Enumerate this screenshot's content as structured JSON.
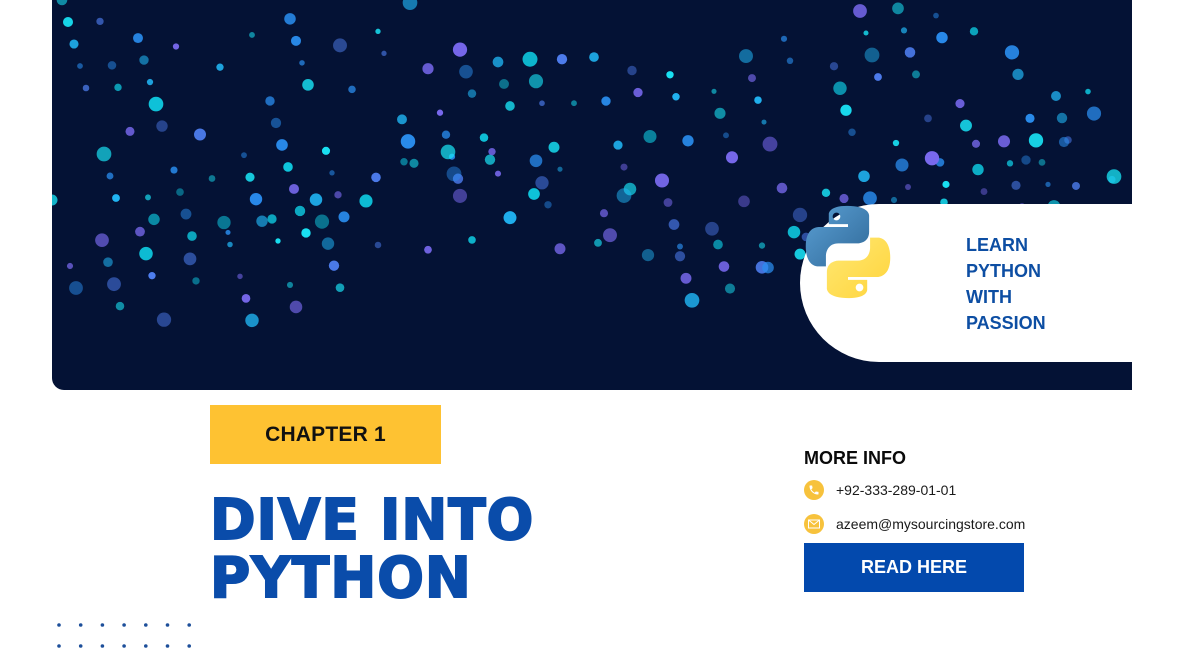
{
  "banner": {
    "background_color": "#041235",
    "dot_colors": [
      "#19e3f5",
      "#21b6f5",
      "#2a8ef0",
      "#4f7ff2",
      "#7a6af0",
      "#0fd0e6"
    ]
  },
  "badge": {
    "logo_icon": "python-logo-icon",
    "tagline_lines": [
      "LEARN",
      "PYTHON",
      "WITH",
      "PASSION"
    ],
    "tagline_color": "#0d4ea3"
  },
  "chapter": {
    "label": "CHAPTER 1",
    "background_color": "#fec232"
  },
  "headline": {
    "lines": [
      "DIVE INTO",
      "PYTHON"
    ],
    "color": "#0a4caa"
  },
  "info": {
    "title": "MORE INFO",
    "phone_icon": "phone-icon",
    "phone": "+92-333-289-01-01",
    "email_icon": "mail-icon",
    "email": "azeem@mysourcingstore.com",
    "icon_color": "#f7c23c"
  },
  "cta": {
    "label": "READ HERE",
    "color": "#0349ad"
  },
  "decoration": {
    "dot_grid": {
      "rows": 2,
      "cols": 7,
      "color": "#1d4f9a"
    }
  }
}
